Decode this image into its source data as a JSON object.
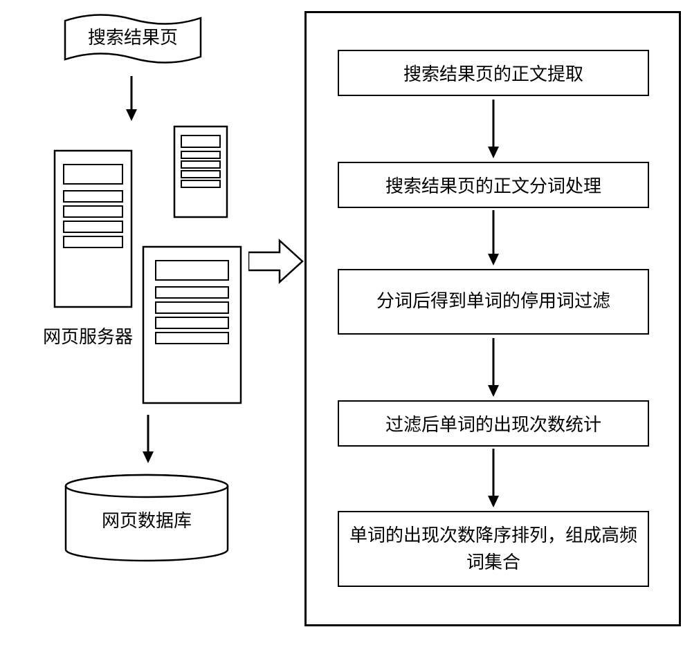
{
  "left_panel": {
    "search_page_label": "搜索结果页",
    "server_label": "网页服务器",
    "database_label": "网页数据库"
  },
  "flowchart": {
    "steps": [
      "搜索结果页的正文提取",
      "搜索结果页的正文分词处理",
      "分词后得到单词的停用词过滤",
      "过滤后单词的出现次数统计",
      "单词的出现次数降序排列，组成高频词集合"
    ]
  }
}
